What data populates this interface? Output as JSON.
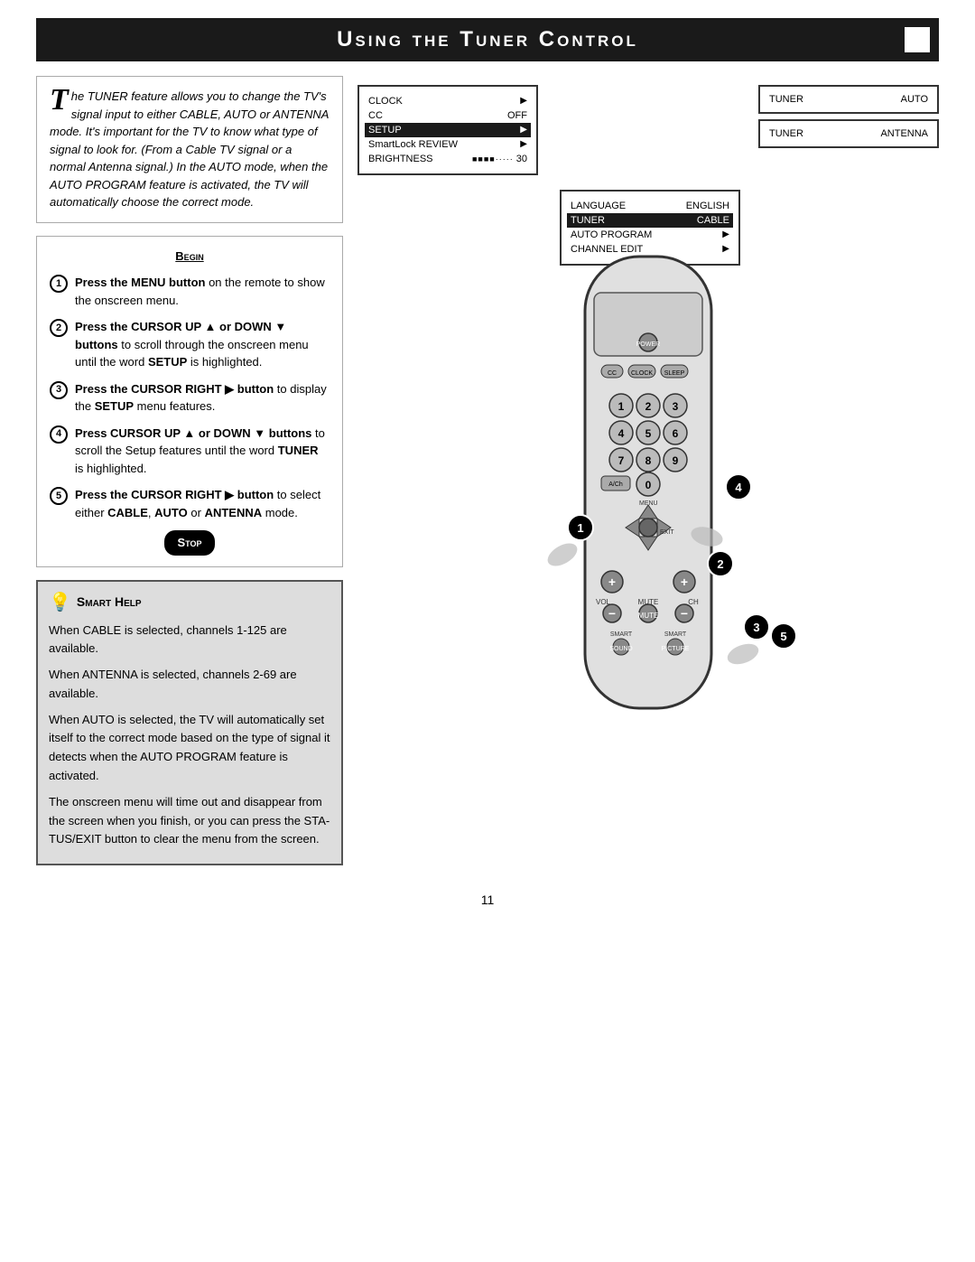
{
  "header": {
    "title": "Using the Tuner Control"
  },
  "intro": {
    "drop_cap": "T",
    "text": "he TUNER feature allows you to change the TV's signal input to either CABLE, AUTO or ANTENNA mode. It's important for the TV to know what type of signal to look for. (From a Cable TV signal or a normal Antenna signal.) In the AUTO mode, when the AUTO PROGRAM feature is activated, the TV will automatically choose the correct mode."
  },
  "begin_label": "Begin",
  "steps": [
    {
      "num": "1",
      "text": "Press the MENU button on the remote to show the onscreen menu."
    },
    {
      "num": "2",
      "text": "Press the CURSOR UP ▲ or DOWN ▼ buttons to scroll through the onscreen menu until the word SETUP is highlighted."
    },
    {
      "num": "3",
      "text": "Press the CURSOR RIGHT ▶ button to display the SETUP menu features."
    },
    {
      "num": "4",
      "text": "Press CURSOR UP ▲ or DOWN ▼ buttons to scroll the Setup features until the word TUNER is highlighted."
    },
    {
      "num": "5",
      "text": "Press the CURSOR RIGHT ▶ button to select either CABLE, AUTO or ANTENNA mode."
    }
  ],
  "stop_label": "Stop",
  "smart_help": {
    "title": "Smart Help",
    "text1": "When CABLE is selected, channels 1-125 are available.",
    "text2": "When ANTENNA is selected, channels 2-69 are available.",
    "text3": "When AUTO is selected, the TV will automatically set itself to the correct mode based on the type of signal it detects when the AUTO PROGRAM feature is activated.",
    "text4": "The onscreen menu will time out and disappear from the screen when you finish, or you can press the STA-TUS/EXIT button to clear the menu from the screen."
  },
  "onscreen_menu": {
    "items": [
      {
        "label": "CLOCK",
        "value": "▶",
        "highlighted": false
      },
      {
        "label": "CC",
        "value": "OFF",
        "highlighted": false
      },
      {
        "label": "SETUP",
        "value": "▶",
        "highlighted": true
      },
      {
        "label": "SmartLock REVIEW",
        "value": "▶",
        "highlighted": false
      },
      {
        "label": "BRIGHTNESS",
        "value": "■■■■·····  30",
        "highlighted": false
      }
    ]
  },
  "setup_menu": {
    "items": [
      {
        "label": "LANGUAGE",
        "value": "ENGLISH",
        "highlighted": false
      },
      {
        "label": "TUNER",
        "value": "CABLE",
        "highlighted": true
      },
      {
        "label": "AUTO PROGRAM",
        "value": "▶",
        "highlighted": false
      },
      {
        "label": "CHANNEL EDIT",
        "value": "▶",
        "highlighted": false
      }
    ]
  },
  "tuner_states": [
    {
      "label": "TUNER",
      "value": "AUTO"
    },
    {
      "label": "TUNER",
      "value": "ANTENNA"
    }
  ],
  "page_number": "11"
}
